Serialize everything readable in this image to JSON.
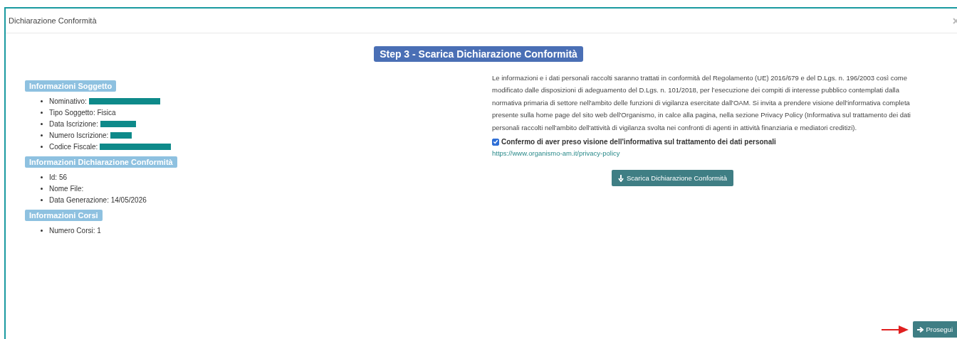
{
  "window": {
    "title": "Dichiarazione Conformità"
  },
  "step_title": "Step 3 - Scarica Dichiarazione Conformità",
  "sections": [
    {
      "title": "Informazioni Soggetto",
      "items": [
        {
          "label": "Nominativo:",
          "redacted": true
        },
        {
          "label": "Tipo Soggetto: Fisica",
          "redacted": false
        },
        {
          "label": "Data Iscrizione:",
          "redacted": true
        },
        {
          "label": "Numero Iscrizione:",
          "redacted": true
        },
        {
          "label": "Codice Fiscale:",
          "redacted": true
        }
      ]
    },
    {
      "title": "Informazioni Dichiarazione Conformità",
      "items": [
        {
          "label": "Id: 56",
          "redacted": false
        },
        {
          "label": "Nome File:",
          "redacted": false
        },
        {
          "label": "Data Generazione: 14/05/2026",
          "redacted": false
        }
      ]
    },
    {
      "title": "Informazioni Corsi",
      "items": [
        {
          "label": "Numero Corsi: 1",
          "redacted": false
        }
      ]
    }
  ],
  "privacy_text": "Le informazioni e i dati personali raccolti saranno trattati in conformità del Regolamento (UE) 2016/679 e del D.Lgs. n. 196/2003 così come modificato dalle disposizioni di adeguamento del D.Lgs. n. 101/2018, per l’esecuzione dei compiti di interesse pubblico contemplati dalla normativa primaria di settore nell'ambito delle funzioni di vigilanza esercitate dall'OAM. Si invita a prendere visione dell'informativa completa presente sulla home page del sito web dell'Organismo, in calce alla pagina, nella sezione Privacy Policy (Informativa sul trattamento dei dati personali raccolti nell'ambito dell'attività di vigilanza svolta nei confronti di agenti in attività finanziaria e mediatori creditizi).",
  "consent": {
    "label": "Confermo di aver preso visione dell'informativa sul trattamento dei dati personali",
    "checked": true
  },
  "privacy_link": "https://www.organismo-am.it/privacy-policy",
  "download_button": "Scarica Dichiarazione Conformità",
  "next_button": "Prosegui"
}
